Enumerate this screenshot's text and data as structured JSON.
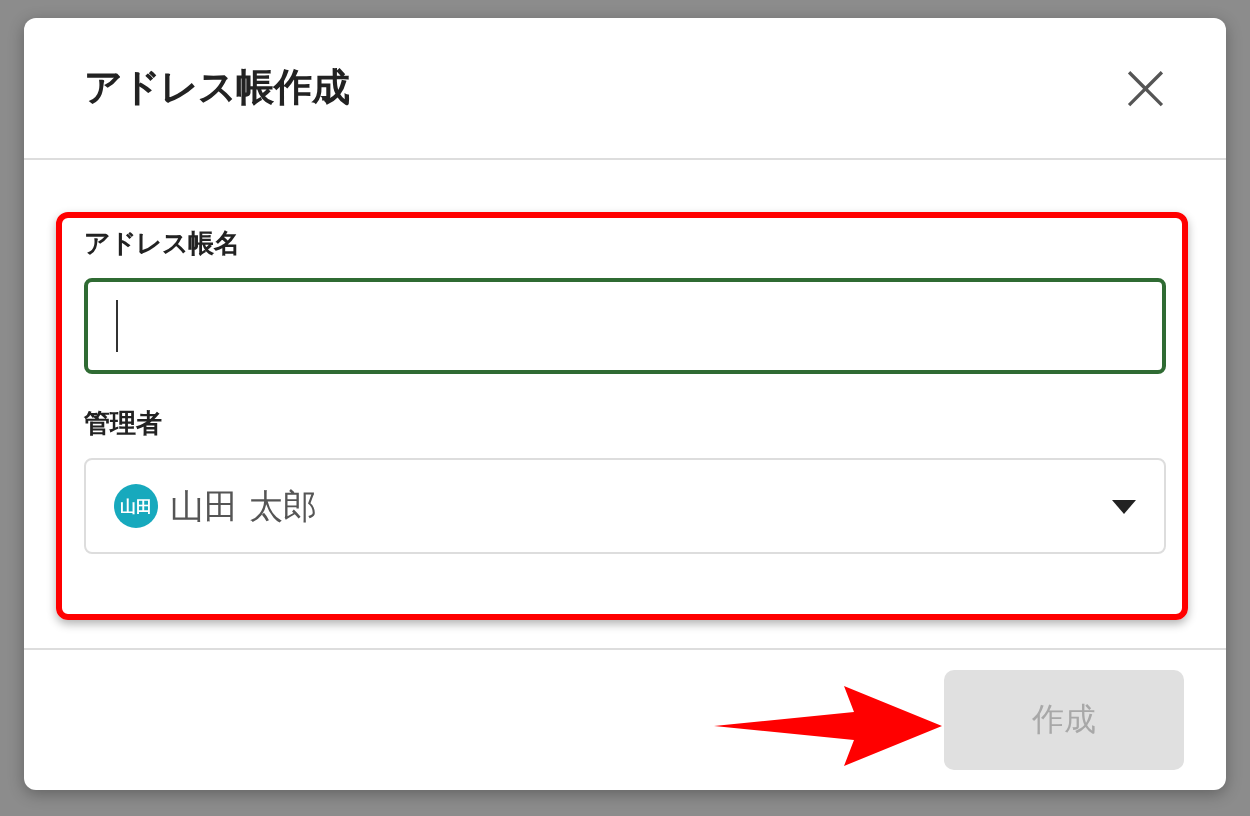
{
  "dialog": {
    "title": "アドレス帳作成",
    "close_icon": "×"
  },
  "fields": [
    {
      "kind": "text",
      "label": "アドレス帳名",
      "focused": true
    },
    {
      "kind": "select",
      "label": "管理者",
      "avatar_text": "山田",
      "value": "山田 太郎",
      "color": "#17a9bd"
    }
  ],
  "footer": {
    "button": {
      "label": "作成",
      "disabled": true
    }
  },
  "annotations": {
    "highlight": true,
    "arrow": true
  }
}
